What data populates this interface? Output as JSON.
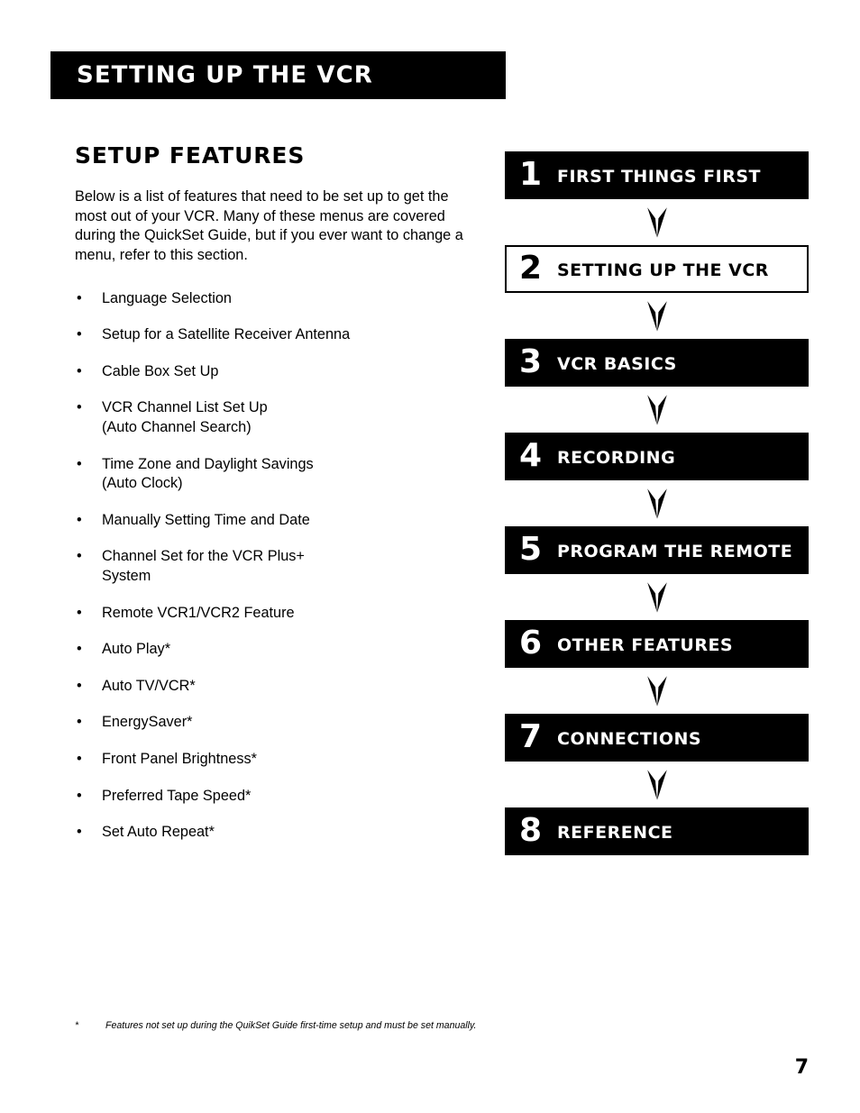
{
  "header": {
    "banner_title": "SETTING UP THE VCR"
  },
  "left": {
    "section_title": "SETUP FEATURES",
    "intro_paragraph": "Below is a list of features that need to be set up to get the most out of your VCR. Many of these menus are covered during the QuickSet Guide, but if you ever want to change a menu, refer to this section.",
    "bullet_char": "•",
    "features": [
      {
        "line1": "Language Selection",
        "line2": ""
      },
      {
        "line1": "Setup for a Satellite Receiver Antenna",
        "line2": ""
      },
      {
        "line1": "Cable Box Set Up",
        "line2": ""
      },
      {
        "line1": "VCR Channel List Set Up",
        "line2": "(Auto Channel Search)"
      },
      {
        "line1": "Time Zone and Daylight Savings",
        "line2": "(Auto Clock)"
      },
      {
        "line1": "Manually Setting Time and Date",
        "line2": ""
      },
      {
        "line1": "Channel Set for the VCR Plus+",
        "line2": "System"
      },
      {
        "line1": "Remote VCR1/VCR2 Feature",
        "line2": ""
      },
      {
        "line1": "Auto Play*",
        "line2": ""
      },
      {
        "line1": "Auto TV/VCR*",
        "line2": ""
      },
      {
        "line1": "EnergySaver*",
        "line2": ""
      },
      {
        "line1": "Front Panel Brightness*",
        "line2": ""
      },
      {
        "line1": "Preferred Tape Speed*",
        "line2": ""
      },
      {
        "line1": "Set Auto Repeat*",
        "line2": ""
      }
    ]
  },
  "flow_chart": {
    "steps": [
      {
        "number": "1",
        "label": "FIRST THINGS FIRST",
        "style": "dark"
      },
      {
        "number": "2",
        "label": "SETTING UP THE VCR",
        "style": "light"
      },
      {
        "number": "3",
        "label": "VCR BASICS",
        "style": "dark"
      },
      {
        "number": "4",
        "label": "RECORDING",
        "style": "dark"
      },
      {
        "number": "5",
        "label": "PROGRAM THE REMOTE",
        "style": "dark"
      },
      {
        "number": "6",
        "label": "OTHER FEATURES",
        "style": "dark"
      },
      {
        "number": "7",
        "label": "CONNECTIONS",
        "style": "dark"
      },
      {
        "number": "8",
        "label": "REFERENCE",
        "style": "dark"
      }
    ]
  },
  "footer": {
    "footnote_marker": "*",
    "footnote_text": "Features not set up during the QuikSet Guide first-time setup and must be set manually.",
    "page_number": "7"
  },
  "colors": {
    "ink": "#000000",
    "paper": "#ffffff"
  }
}
